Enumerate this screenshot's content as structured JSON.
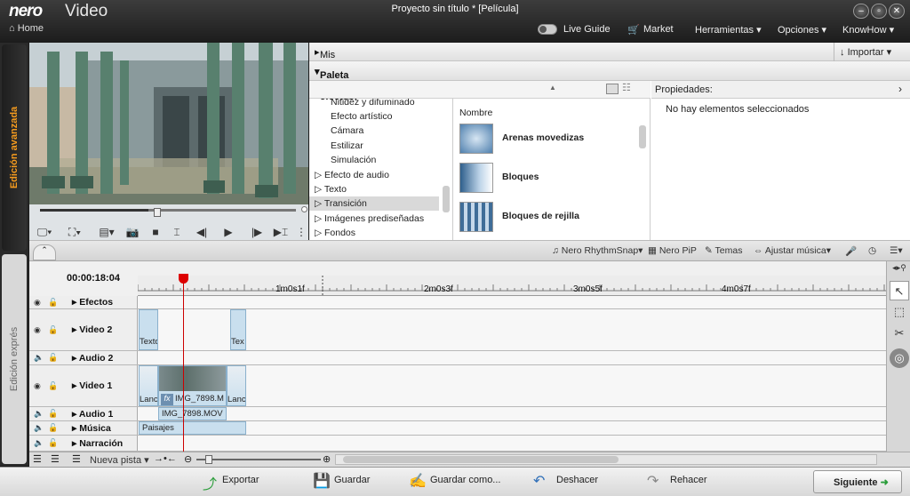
{
  "app": {
    "logo": "nero",
    "product": "Video",
    "title": "Proyecto sin título * [Película]",
    "home": "Home"
  },
  "menu": {
    "live_guide": "Live Guide",
    "market": "Market",
    "herramientas": "Herramientas",
    "opciones": "Opciones",
    "knowhow": "KnowHow"
  },
  "sidebar": {
    "advanced": "Edición avanzada",
    "express": "Edición exprés"
  },
  "panel": {
    "mis_archivos": "Mis archivos multimedia",
    "importar": "Importar",
    "paleta": "Paleta de efectos:",
    "nombre_col": "Nombre",
    "propiedades": "Propiedades:",
    "no_sel": "No hay elementos seleccionados"
  },
  "categories": [
    "Nitidez y difuminado",
    "Efecto artístico",
    "Cámara",
    "Estilizar",
    "Simulación",
    "Efecto de audio",
    "Texto",
    "Transición",
    "Imágenes prediseñadas",
    "Fondos"
  ],
  "effects": [
    "Arenas movedizas",
    "Bloques",
    "Bloques de rejilla"
  ],
  "tl_toolbar": {
    "rhythm": "Nero RhythmSnap",
    "pip": "Nero PiP",
    "temas": "Temas",
    "ajustar": "Ajustar música"
  },
  "timeline": {
    "timecode": "00:00:18:04",
    "ticks": [
      "1m0s1f",
      "2m0s3f",
      "3m0s5f",
      "4m0s7f"
    ],
    "tracks": [
      "Efectos maes...",
      "Video 2",
      "Audio 2",
      "Video 1",
      "Audio 1",
      "Música",
      "Narración"
    ],
    "clips": {
      "v2a": "Texto",
      "v2b": "Tex",
      "v1a": "Lanc",
      "v1b": "IMG_7898.M",
      "v1c": "Lanc",
      "a1": "IMG_7898.MOV",
      "musica": "Paisajes",
      "fx": "fx"
    }
  },
  "tl_footer": {
    "nueva_pista": "Nueva pista"
  },
  "footer": {
    "exportar": "Exportar",
    "guardar": "Guardar",
    "guardar_como": "Guardar como...",
    "deshacer": "Deshacer",
    "rehacer": "Rehacer",
    "siguiente": "Siguiente"
  }
}
